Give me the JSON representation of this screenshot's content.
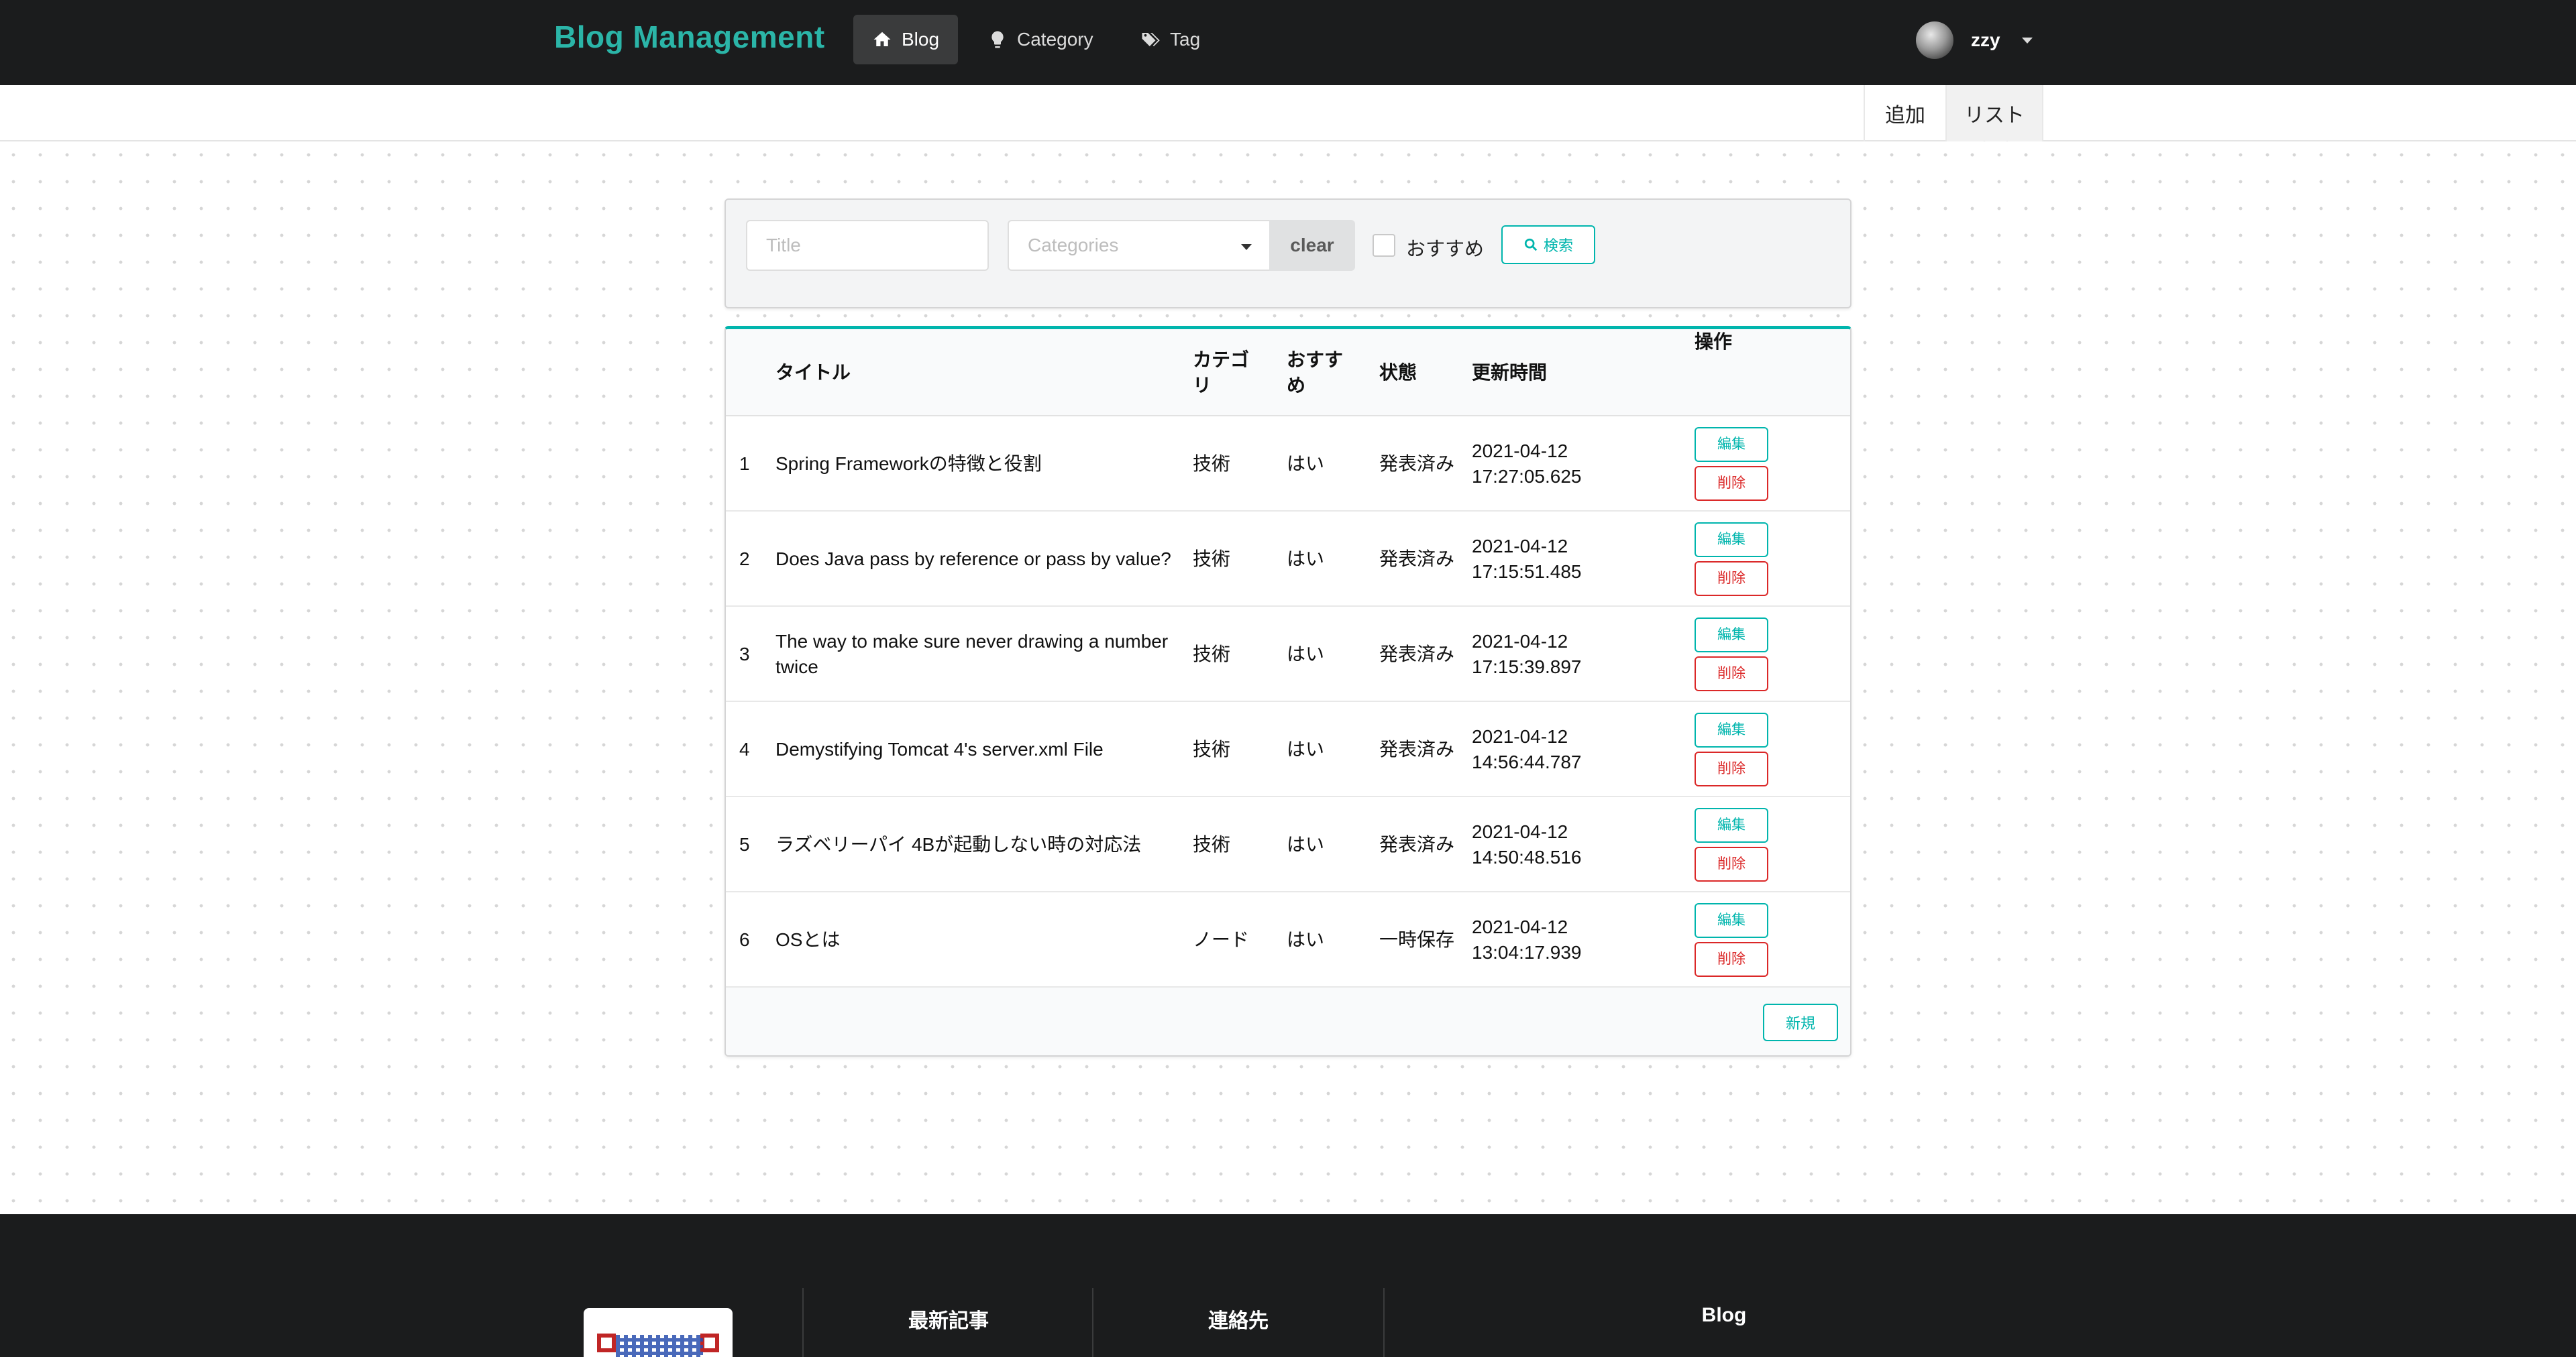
{
  "nav": {
    "brand": "Blog Management",
    "items": [
      {
        "label": "Blog",
        "icon": "home-icon",
        "active": true
      },
      {
        "label": "Category",
        "icon": "lightbulb-icon",
        "active": false
      },
      {
        "label": "Tag",
        "icon": "tags-icon",
        "active": false
      }
    ],
    "user": {
      "name": "zzy"
    }
  },
  "submenu": {
    "add": "追加",
    "list": "リスト"
  },
  "search": {
    "title_placeholder": "Title",
    "category_placeholder": "Categories",
    "clear": "clear",
    "recommend_label": "おすすめ",
    "search_button": "検索"
  },
  "table": {
    "headers": {
      "title": "タイトル",
      "category": "カテゴリ",
      "recommend": "おすすめ",
      "status": "状態",
      "updated": "更新時間",
      "ops": "操作"
    },
    "rows": [
      {
        "num": "1",
        "title": "Spring Frameworkの特徴と役割",
        "category": "技術",
        "recommend": "はい",
        "status": "発表済み",
        "updated": "2021-04-12 17:27:05.625"
      },
      {
        "num": "2",
        "title": "Does Java pass by reference or pass by value?",
        "category": "技術",
        "recommend": "はい",
        "status": "発表済み",
        "updated": "2021-04-12 17:15:51.485"
      },
      {
        "num": "3",
        "title": "The way to make sure never drawing a number twice",
        "category": "技術",
        "recommend": "はい",
        "status": "発表済み",
        "updated": "2021-04-12 17:15:39.897"
      },
      {
        "num": "4",
        "title": "Demystifying Tomcat 4's server.xml File",
        "category": "技術",
        "recommend": "はい",
        "status": "発表済み",
        "updated": "2021-04-12 14:56:44.787"
      },
      {
        "num": "5",
        "title": "ラズベリーパイ 4Bが起動しない時の対応法",
        "category": "技術",
        "recommend": "はい",
        "status": "発表済み",
        "updated": "2021-04-12 14:50:48.516"
      },
      {
        "num": "6",
        "title": "OSとは",
        "category": "ノード",
        "recommend": "はい",
        "status": "一時保存",
        "updated": "2021-04-12 13:04:17.939"
      }
    ],
    "edit_label": "編集",
    "delete_label": "削除",
    "new_label": "新規"
  },
  "footer": {
    "latest": "最新記事",
    "contact": "連絡先",
    "blog": "Blog"
  },
  "colors": {
    "brand": "#2bb5a8",
    "teal": "#00b5ad",
    "red": "#db2828",
    "dark": "#1b1c1d"
  }
}
